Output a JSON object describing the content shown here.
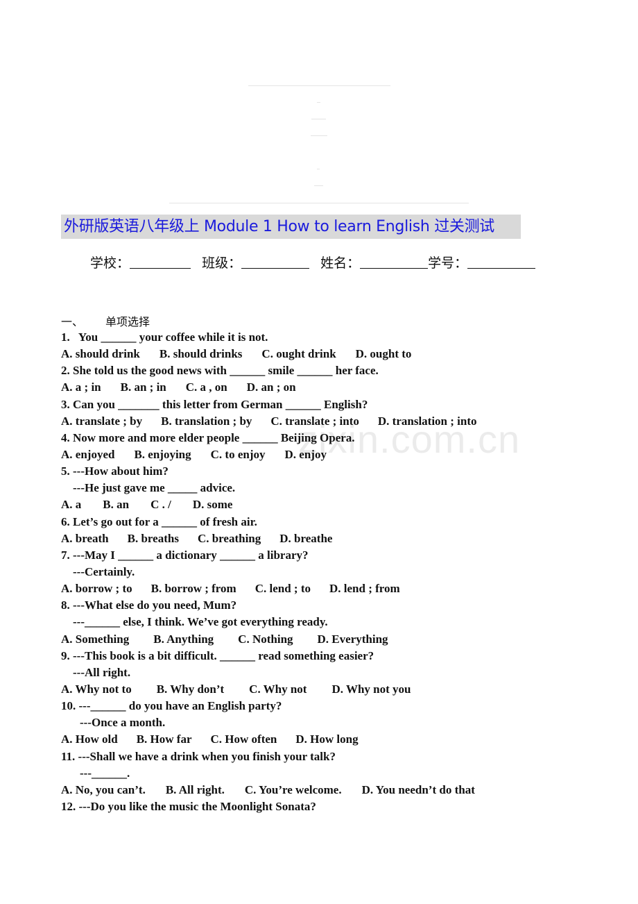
{
  "header": {
    "title": "外研版英语八年级上 Module 1 How to learn English 过关测试",
    "info_fields": [
      {
        "label": "学校：",
        "blank": "________"
      },
      {
        "label": "班级：",
        "blank": "_________"
      },
      {
        "label": "姓名：",
        "blank": "_________"
      },
      {
        "label": "学号：",
        "blank": "_________"
      }
    ]
  },
  "section": {
    "number": "一、",
    "title": "单项选择"
  },
  "questions": [
    {
      "stem": [
        "1.   You ______ your coffee while it is not."
      ],
      "options": [
        "A. should drink",
        "B. should drinks",
        "C. ought drink",
        "D. ought to"
      ]
    },
    {
      "stem": [
        "2. She told us the good news with ______ smile ______ her face."
      ],
      "options": [
        "A. a ; in",
        "B. an ; in",
        "C. a , on",
        "D. an ; on"
      ]
    },
    {
      "stem": [
        "3. Can you _______ this letter from German ______ English?"
      ],
      "options": [
        "A. translate ; by",
        "B. translation ; by",
        "C. translate ; into",
        "D. translation ; into"
      ]
    },
    {
      "stem": [
        "4. Now more and more elder people ______ Beijing Opera."
      ],
      "options": [
        "A. enjoyed",
        "B. enjoying",
        "C. to enjoy",
        "D. enjoy"
      ]
    },
    {
      "stem": [
        "5. ---How about him?",
        "---He just gave me _____ advice."
      ],
      "options": [
        "A. a",
        "B. an",
        "C . /",
        "D. some"
      ]
    },
    {
      "stem": [
        "6. Let’s go out for a ______ of fresh air."
      ],
      "options": [
        "A. breath",
        "B. breaths",
        "C. breathing",
        "D. breathe"
      ]
    },
    {
      "stem": [
        "7. ---May I ______ a dictionary ______ a library?",
        "---Certainly."
      ],
      "options": [
        "A. borrow ; to",
        "B. borrow ; from",
        "C. lend ; to",
        "D. lend ; from"
      ]
    },
    {
      "stem": [
        "8. ---What else do you need, Mum?",
        "---______ else, I think. We’ve got everything ready."
      ],
      "options": [
        "A. Something",
        "B. Anything",
        "C. Nothing",
        "D. Everything"
      ]
    },
    {
      "stem": [
        "9. ---This book is a bit difficult. ______ read something easier?",
        "---All right."
      ],
      "options": [
        "A. Why not to",
        "B. Why don’t",
        "C. Why not",
        "D. Why not you"
      ]
    },
    {
      "stem": [
        "10. ---______ do you have an English party?",
        "---Once a month."
      ],
      "options": [
        "A. How old",
        "B. How far",
        "C. How often",
        "D. How long"
      ]
    },
    {
      "stem": [
        "11. ---Shall we have a drink when you finish your talk?",
        "---______."
      ],
      "options": [
        "A. No, you can’t.",
        "B. All right.",
        "C. You’re welcome.",
        "D. You needn’t do that"
      ]
    },
    {
      "stem": [
        "12. ---Do you like the music the Moonlight Sonata?"
      ],
      "options": []
    }
  ],
  "watermark": "zixin.com.cn"
}
